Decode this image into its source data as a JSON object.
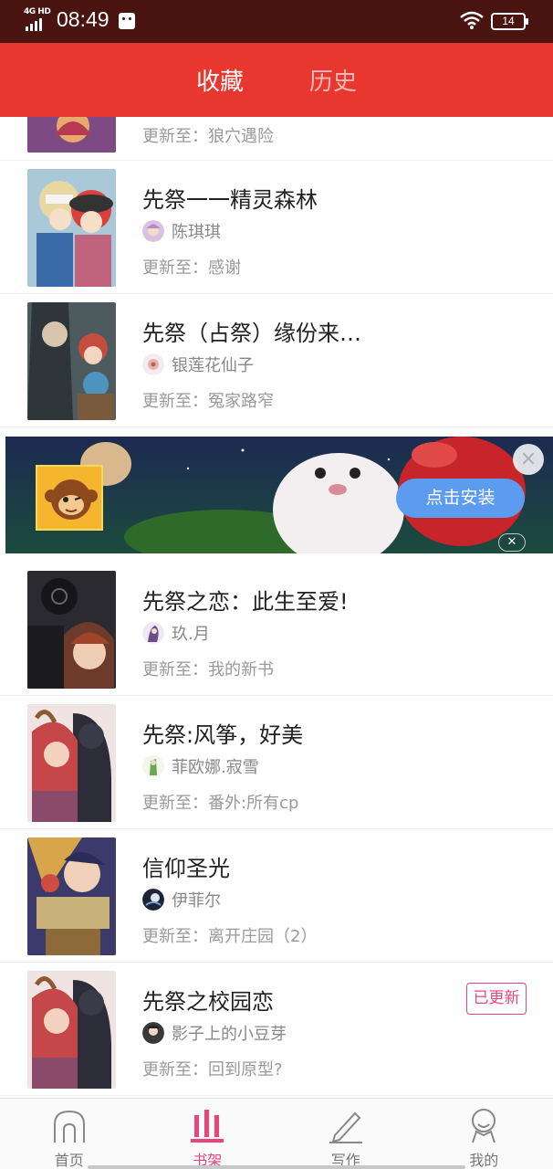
{
  "status_bar": {
    "network": "4G HD",
    "time": "08:49",
    "battery": "14"
  },
  "tabs": [
    {
      "label": "收藏",
      "active": true
    },
    {
      "label": "历史",
      "active": false
    }
  ],
  "accent_color": "#e8372e",
  "update_prefix": "更新至：",
  "items": [
    {
      "title": "",
      "author": "",
      "update_label": "更新至：狼穴遇险",
      "badge": ""
    },
    {
      "title": "先祭一一精灵森林",
      "author": "陈琪琪",
      "update_label": "更新至：感谢",
      "badge": ""
    },
    {
      "title": "先祭（占祭）缘份来…",
      "author": "银莲花仙子",
      "update_label": "更新至：冤家路窄",
      "badge": ""
    },
    {
      "title": "先祭之恋：此生至爱!",
      "author": "玖.月",
      "update_label": "更新至：我的新书",
      "badge": ""
    },
    {
      "title": "先祭:风筝，好美",
      "author": "菲欧娜.寂雪",
      "update_label": "更新至：番外:所有cp",
      "badge": ""
    },
    {
      "title": "信仰圣光",
      "author": "伊菲尔",
      "update_label": "更新至：离开庄园（2）",
      "badge": ""
    },
    {
      "title": "先祭之校园恋",
      "author": "影子上的小豆芽",
      "update_label": "更新至：回到原型?",
      "badge": "已更新"
    }
  ],
  "ad": {
    "install_label": "点击安装",
    "close_label": "×"
  },
  "bottom_nav": [
    {
      "label": "首页",
      "icon": "home-icon",
      "active": false
    },
    {
      "label": "书架",
      "icon": "bookshelf-icon",
      "active": true
    },
    {
      "label": "写作",
      "icon": "pencil-icon",
      "active": false
    },
    {
      "label": "我的",
      "icon": "profile-icon",
      "active": false
    }
  ]
}
